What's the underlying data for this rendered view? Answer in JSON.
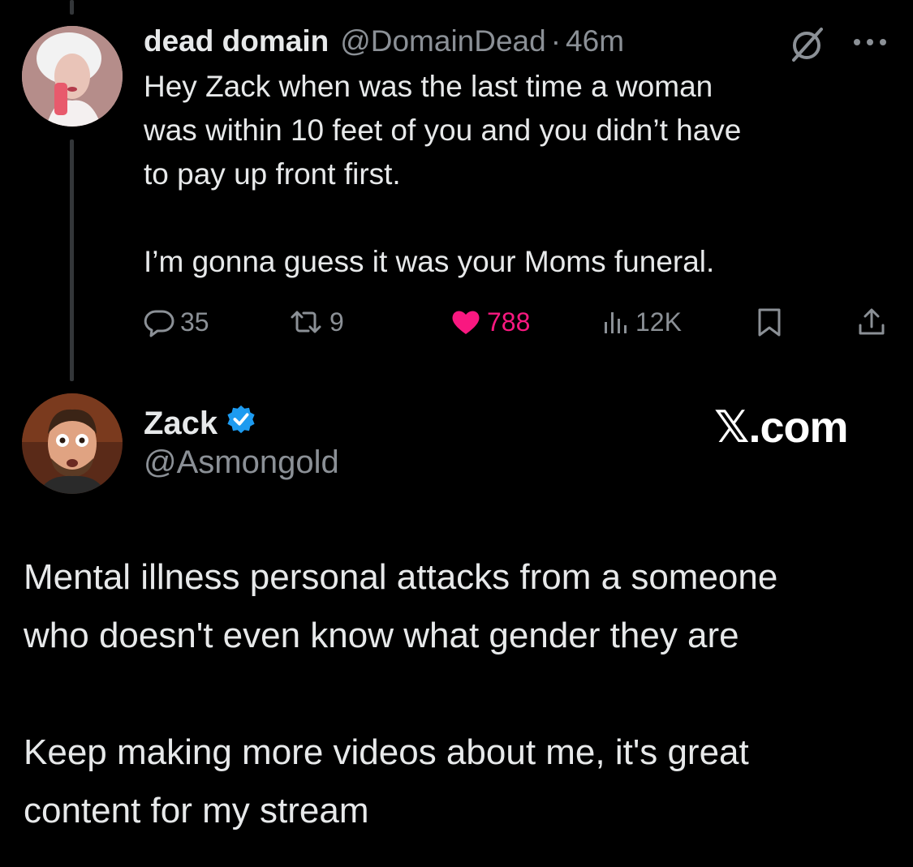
{
  "reply_tweet": {
    "display_name": "dead domain",
    "handle": "@DomainDead",
    "separator": "·",
    "time": "46m",
    "text_lines": [
      "Hey Zack when was the last time a woman",
      "was within 10 feet of you and you didn’t have",
      "to pay up front first.",
      "I’m gonna guess it was your Moms funeral."
    ],
    "metrics": {
      "replies": "35",
      "reposts": "9",
      "likes": "788",
      "views": "12K"
    },
    "icons": [
      "grok-icon",
      "more-icon",
      "reply-icon",
      "repost-icon",
      "heart-icon",
      "views-icon",
      "bookmark-icon",
      "share-icon"
    ]
  },
  "response_tweet": {
    "display_name": "Zack",
    "handle": "@Asmongold",
    "verified": true,
    "site_mark": "𝕏.com",
    "text_lines": [
      "Mental illness personal attacks from a someone",
      "who doesn't even know what gender they are",
      "Keep making more videos about me, it's great",
      "content for my stream"
    ]
  },
  "colors": {
    "background": "#000000",
    "text": "#e7e9ea",
    "secondary": "#8b9096",
    "like": "#f91880",
    "verified": "#1d9bf0"
  }
}
